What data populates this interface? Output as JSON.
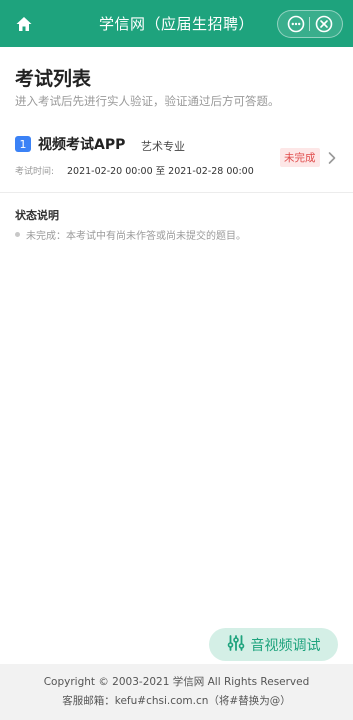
{
  "header": {
    "title": "学信网（应届生招聘）",
    "home_icon": "home-icon",
    "more_icon": "more-dots-icon",
    "close_icon": "close-circle-icon",
    "color": "#1ea37d"
  },
  "page": {
    "title": "考试列表",
    "subtitle": "进入考试后先进行实人验证，验证通过后方可答题。"
  },
  "exams": [
    {
      "index": "1",
      "name": "视频考试APP",
      "major": "艺术专业",
      "time_label": "考试时间:",
      "time_value": "2021-02-20 00:00 至 2021-02-28 00:00",
      "status": "未完成"
    }
  ],
  "legend": {
    "title": "状态说明",
    "text": "未完成：本考试中有尚未作答或尚未提交的题目。"
  },
  "debug_button": {
    "label": "音视频调试",
    "icon": "sliders-icon"
  },
  "footer": {
    "copyright": "Copyright © 2003-2021 学信网 All Rights Reserved",
    "email": "客服邮箱：kefu#chsi.com.cn（将#替换为@）"
  }
}
